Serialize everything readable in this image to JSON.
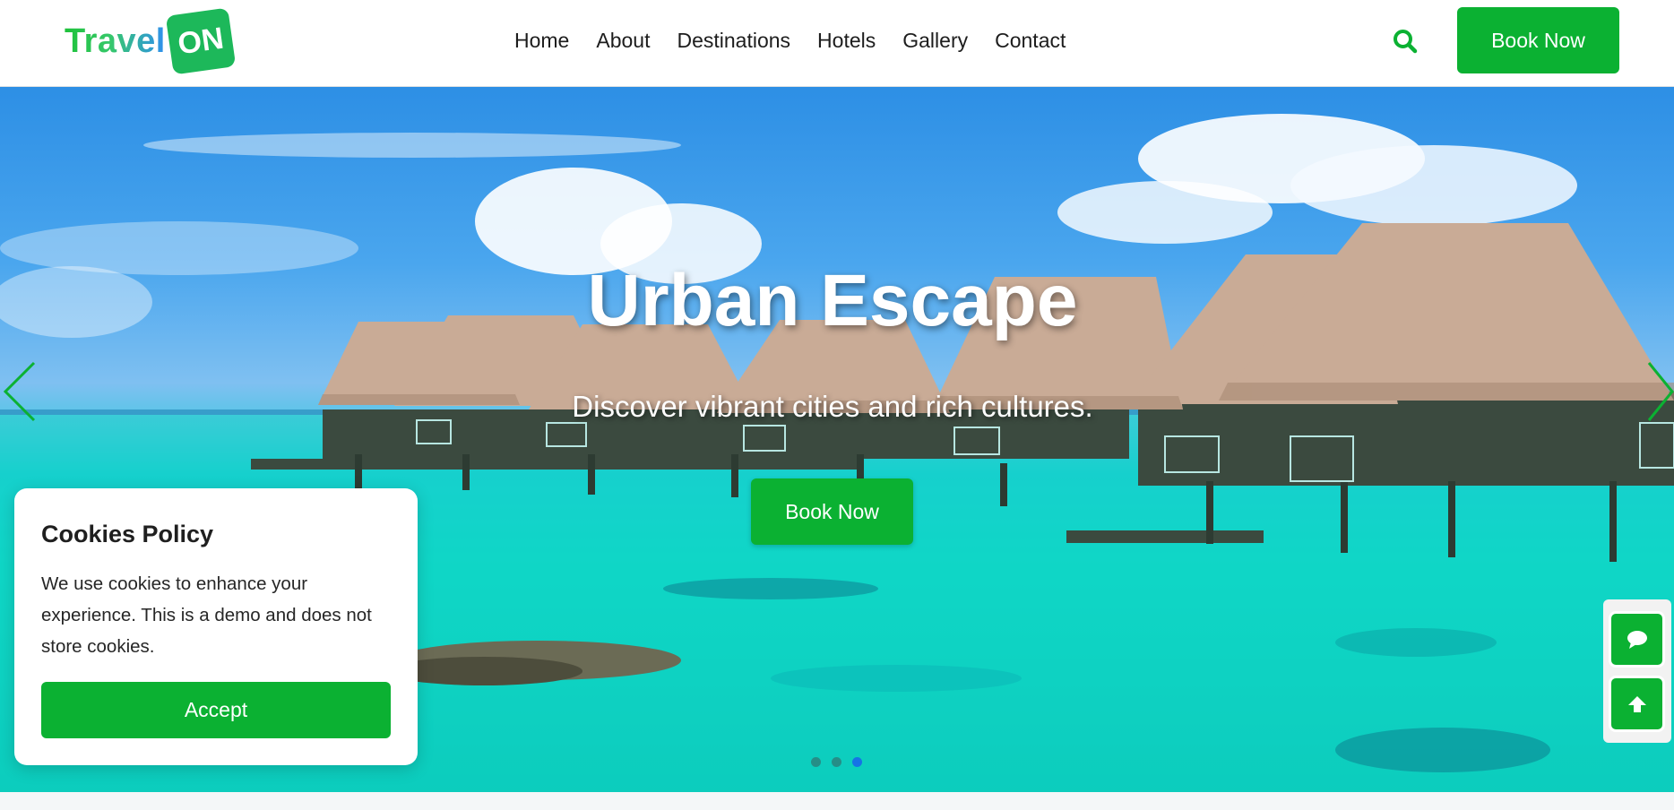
{
  "brand": {
    "name": "Travel",
    "badge": "ON"
  },
  "nav": {
    "items": [
      "Home",
      "About",
      "Destinations",
      "Hotels",
      "Gallery",
      "Contact"
    ]
  },
  "header": {
    "book_label": "Book Now"
  },
  "hero": {
    "title": "Urban Escape",
    "subtitle": "Discover vibrant cities and rich cultures.",
    "book_label": "Book Now",
    "slides_total": 3,
    "active_slide": 3
  },
  "cookie": {
    "title": "Cookies Policy",
    "text": "We use cookies to enhance your experience. This is a demo and does not store cookies.",
    "accept_label": "Accept"
  },
  "icons": {
    "search": "search-icon",
    "prev": "chevron-left-icon",
    "next": "chevron-right-icon",
    "chat": "chat-icon",
    "top": "arrow-up-icon"
  },
  "colors": {
    "accent": "#0bb132",
    "dot_active": "#1673e6"
  }
}
